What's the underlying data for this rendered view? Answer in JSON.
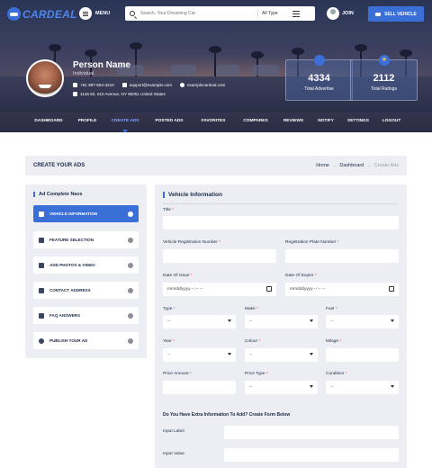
{
  "brand": {
    "name": "CARDEAL"
  },
  "header": {
    "menu_label": "MENU",
    "search_placeholder": "Search, Your Dreaming Car",
    "search_type": "All Type",
    "join_label": "JOIN",
    "sell_label": "SELL VEHICLE"
  },
  "profile": {
    "name": "Person Name",
    "role": "Individual",
    "phone": "+91 987-654-3210",
    "email": "support@example.com",
    "website": "examplecardeal.com",
    "address": "1146 50, 010 Avenue, NY 90001 United States"
  },
  "stats": [
    {
      "value": "4334",
      "label": "Total Advertise"
    },
    {
      "value": "2112",
      "label": "Total Ratings"
    }
  ],
  "nav": [
    "DASHBOARD",
    "PROFILE",
    "CREATE ADS",
    "POSTED ADS",
    "FAVORITES",
    "COMPARES",
    "REVIEWS",
    "NOTIFY",
    "SETTINGS",
    "LOGOUT"
  ],
  "breadcrumb": {
    "title": "CREATE YOUR ADS",
    "home": "Home",
    "sep": "→",
    "mid": "Dashboard",
    "current": "Create Ads"
  },
  "sidebar": {
    "title": "Ad Complete Navs",
    "items": [
      "VEHICLE INFORMATION",
      "FEATURE SELECTION",
      "ADD PHOTOS & VIDEO",
      "CONTACT ADDRESS",
      "FAQ ANSWERS",
      "PUBLISH YOUR AD"
    ]
  },
  "form": {
    "title": "Vehicle Information",
    "title_field": "Title",
    "reg_number": "Vehicle Registration Number",
    "plate_number": "Registration Plate Number",
    "date_issue": "Date Of Issue",
    "date_expire": "Date Of Expire",
    "date_placeholder": "mm/dd/yyyy --:-- --",
    "type": "Type",
    "make": "Make",
    "fuel": "Fuel",
    "year": "Year",
    "colour": "Colour",
    "milage": "Milage",
    "price_amount": "Price Amount",
    "price_type": "Price Type",
    "condition": "Condition",
    "select_placeholder": "--",
    "req_mark": "*",
    "extra_title": "Do You Have Extra Information To Add? Create Form Below",
    "input_label": "Input Label",
    "input_value": "Input Value"
  }
}
